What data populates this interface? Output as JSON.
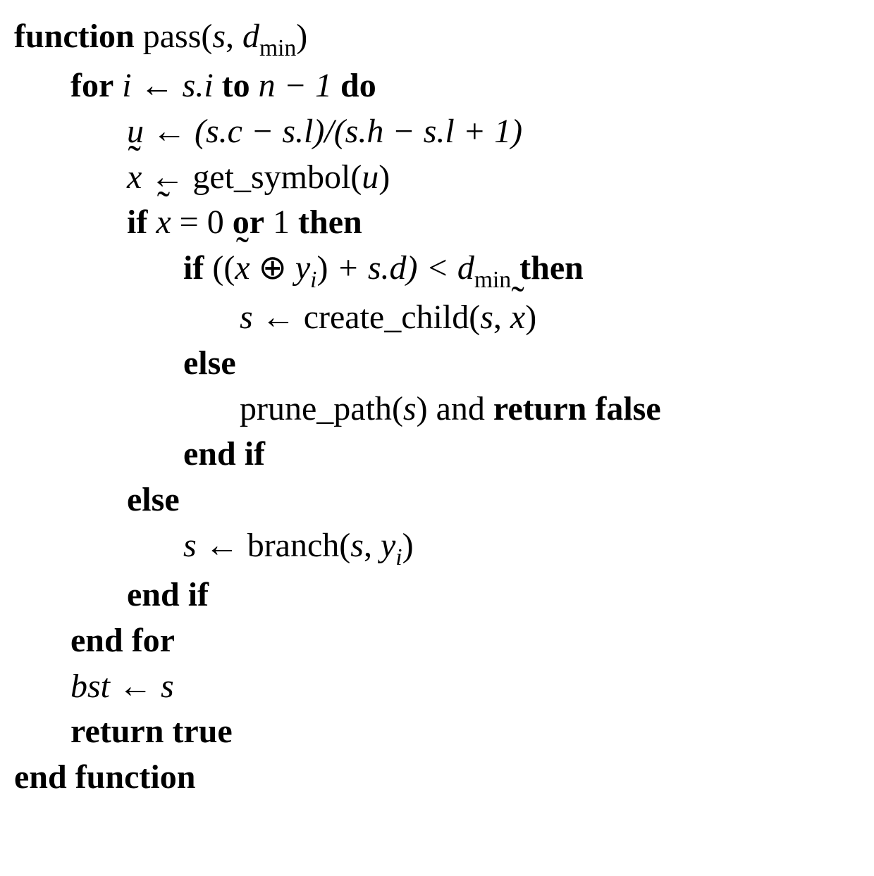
{
  "kw": {
    "function": "function",
    "for": "for",
    "to": "to",
    "do": "do",
    "if": "if",
    "then": "then",
    "else": "else",
    "endif": "end if",
    "endfor": "end for",
    "return": "return",
    "endfunction": "end function",
    "and": "and",
    "or": "or",
    "true": "true",
    "false": "false"
  },
  "fn": {
    "pass": "pass",
    "get_symbol": "get_symbol",
    "create_child": "create_child",
    "prune_path": "prune_path",
    "branch": "branch"
  },
  "sym": {
    "xtilde": "x",
    "s": "s",
    "dmin_d": "d",
    "dmin_sub": "min",
    "i": "i",
    "si": "s.i",
    "n_minus_1": "n − 1",
    "u": "u",
    "u_expr": "(s.c − s.l)/(s.h − s.l + 1)",
    "zero_or_one": "= 0",
    "one": "1",
    "plus_sd": "+ s.d) <",
    "y": "y",
    "bst": "bst",
    "larrow": "←",
    "oplus": "⊕",
    "comma": ","
  }
}
